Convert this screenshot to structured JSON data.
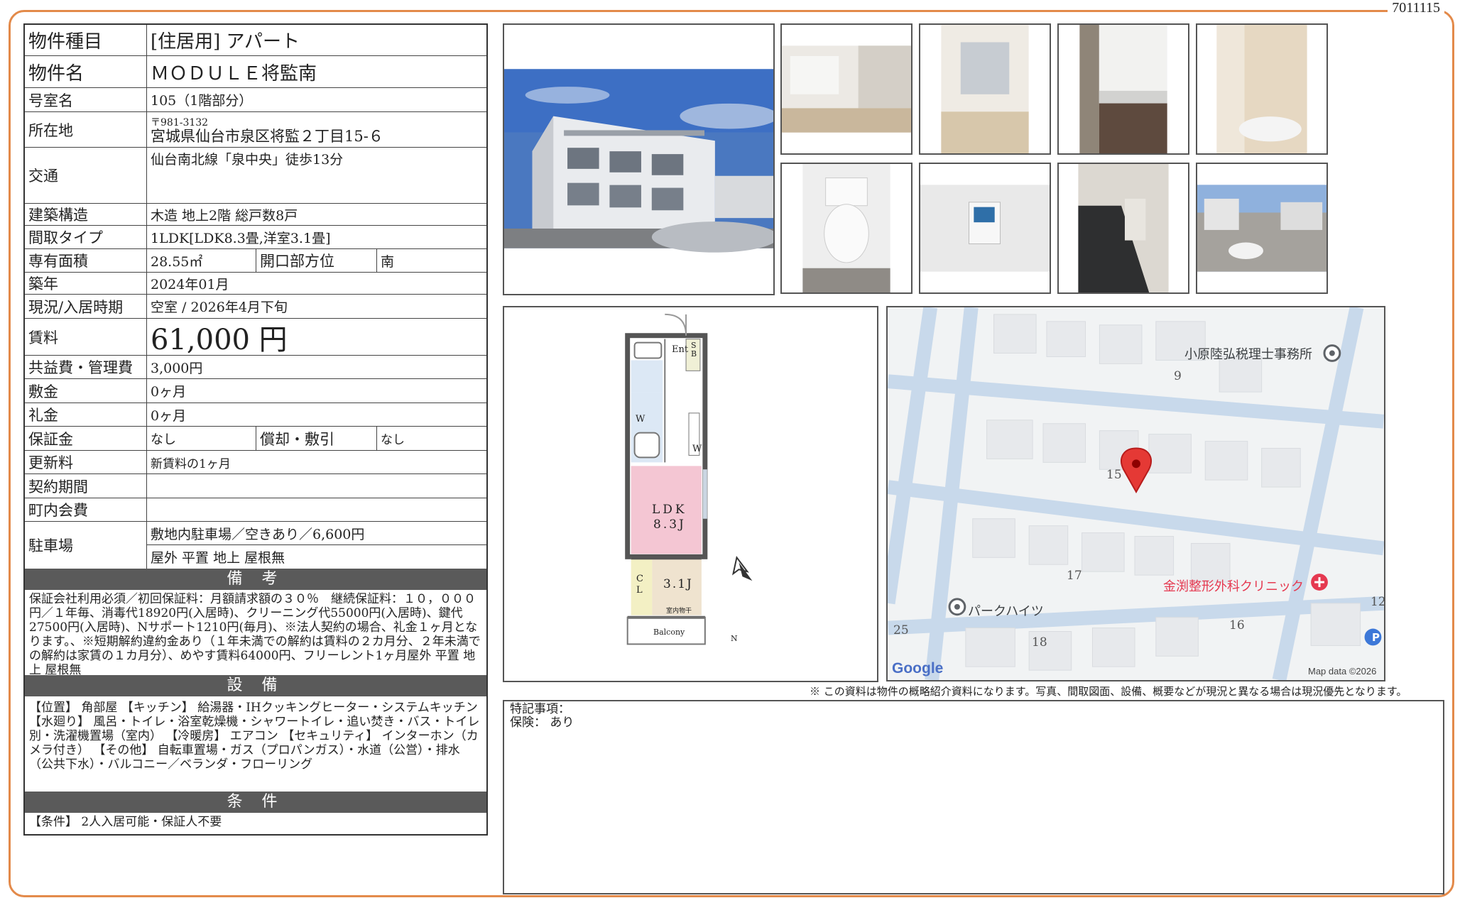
{
  "doc_id": "7011115",
  "spec": {
    "type_label": "物件種目",
    "type_value": "[住居用] アパート",
    "name_label": "物件名",
    "name_value": "ＭＯＤＵＬＥ将監南",
    "room_label": "号室名",
    "room_value": "105（1階部分）",
    "address_label": "所在地",
    "postal": "〒981-3132",
    "address_value": "宮城県仙台市泉区将監２丁目15-６",
    "traffic_label": "交通",
    "traffic_value": "仙台南北線「泉中央」徒歩13分",
    "structure_label": "建築構造",
    "structure_value": "木造  地上2階  総戸数8戸",
    "layout_label": "間取タイプ",
    "layout_value": "1LDK[LDK8.3畳,洋室3.1畳]",
    "area_label": "専有面積",
    "area_value": "28.55㎡",
    "direction_label": "開口部方位",
    "direction_value": "南",
    "built_label": "築年",
    "built_value": "2024年01月",
    "status_label": "現況/入居時期",
    "status_value": "空室  /  2026年4月下旬",
    "rent_label": "賃料",
    "rent_value": "61,000 円",
    "fee_label": "共益費・管理費",
    "fee_value": "3,000円",
    "deposit_label": "敷金",
    "deposit_value": "0ヶ月",
    "key_label": "礼金",
    "key_value": "0ヶ月",
    "guarantee_label": "保証金",
    "guarantee_value": "なし",
    "amort_label": "償却・敷引",
    "amort_value": "なし",
    "renewal_label": "更新料",
    "renewal_value": "新賃料の1ヶ月",
    "term_label": "契約期間",
    "term_value": "",
    "assoc_label": "町内会費",
    "assoc_value": "",
    "parking_label": "駐車場",
    "parking_value1": "敷地内駐車場／空きあり／6,600円",
    "parking_value2": "屋外  平置  地上  屋根無"
  },
  "remarks": {
    "title": "備 考",
    "text": "保証会社利用必須／初回保証料：月額請求額の３０％　継続保証料：１０，０００円／１年毎、消毒代18920円(入居時)、クリーニング代55000円(入居時)、鍵代27500円(入居時)、Nサポート1210円(毎月)、※法人契約の場合、礼金１ヶ月となります。、※短期解約違約金あり（１年未満での解約は賃料の２カ月分、２年未満での解約は家賃の１カ月分）、めやす賃料64000円、フリーレント1ヶ月屋外  平置  地上  屋根無"
  },
  "equipment": {
    "title": "設 備",
    "text": "【位置】 角部屋 【キッチン】 給湯器・IHクッキングヒーター・システムキッチン 【水廻り】 風呂・トイレ・浴室乾燥機・シャワートイレ・追い焚き・バス・トイレ別・洗濯機置場（室内） 【冷暖房】 エアコン 【セキュリティ】 インターホン（カメラ付き） 【その他】 自転車置場・ガス（プロパンガス）・水道（公営）・排水（公共下水）・バルコニー／ベランダ・フローリング"
  },
  "conditions": {
    "title": "条 件",
    "text": "【条件】 2人入居可能・保証人不要"
  },
  "floorplan": {
    "ent": "Ent",
    "sb": "SB",
    "w1": "W",
    "w2": "W",
    "ldk": "LDK",
    "ldk_size": "8.3J",
    "cl": "CL",
    "room_size": "3.1J",
    "storage": "室内物干",
    "balcony": "Balcony",
    "north": "N"
  },
  "map": {
    "poi1": "小原陸弘税理士事務所",
    "poi2": "金渕整形外科クリニック",
    "poi3": "パークハイツ",
    "n9": "9",
    "n15": "15",
    "n17": "17",
    "n16": "16",
    "n18": "18",
    "n25": "25",
    "n12": "12",
    "p": "P",
    "logo": "Google",
    "credit": "Map data ©2026"
  },
  "notice": "※ この資料は物件の概略紹介資料になります。写真、間取図面、設備、概要などが現況と異なる場合は現況優先となります。",
  "notes": {
    "line1": "特記事項：",
    "line2": "保険：  あり"
  }
}
